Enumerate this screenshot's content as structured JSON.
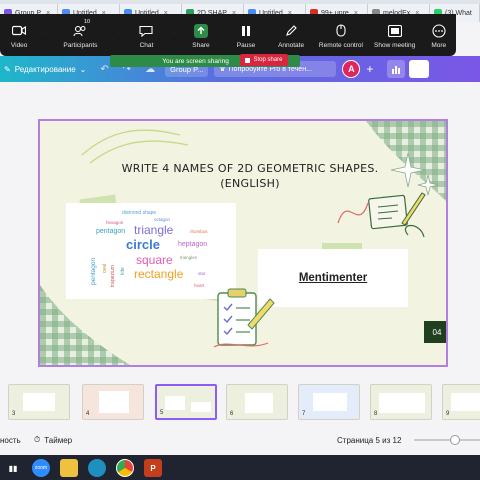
{
  "browser": {
    "tabs": [
      {
        "label": "Group P",
        "color": "#7a57e6"
      },
      {
        "label": "Untitled",
        "color": "#4c8bf5"
      },
      {
        "label": "Untitled",
        "color": "#4c8bf5"
      },
      {
        "label": "2D SHAP",
        "color": "#2aa05a"
      },
      {
        "label": "Untitled",
        "color": "#4c8bf5"
      },
      {
        "label": "99+ unre",
        "color": "#d93025"
      },
      {
        "label": "melodEx",
        "color": "#8a8a8a"
      },
      {
        "label": "(3) What",
        "color": "#25d366"
      }
    ]
  },
  "zoom": {
    "items": [
      {
        "label": "Video",
        "icon": "video-icon"
      },
      {
        "label": "Participants",
        "icon": "participants-icon",
        "count": "10"
      },
      {
        "label": "Chat",
        "icon": "chat-icon"
      },
      {
        "label": "Share",
        "icon": "share-screen-icon"
      },
      {
        "label": "Pause",
        "icon": "pause-icon"
      },
      {
        "label": "Annotate",
        "icon": "annotate-icon"
      },
      {
        "label": "Remote control",
        "icon": "remote-control-icon"
      },
      {
        "label": "Show meeting",
        "icon": "show-meeting-icon"
      },
      {
        "label": "More",
        "icon": "more-icon"
      }
    ],
    "sharing_text": "You are screen sharing",
    "stop_share": "Stop share",
    "accent": "#2e8b47",
    "stop_color": "#d7263d"
  },
  "app": {
    "mode": "Редактирование",
    "group_label": "Group P...",
    "pro_text": "Попробуйте Pro в течен...",
    "avatar": "A"
  },
  "slide": {
    "title": "WRITE 4 NAMES OF 2D GEOMETRIC SHAPES. (ENGLISH)",
    "mentimeter": "Mentimenter",
    "page": "04",
    "wordcloud": [
      {
        "text": "diamond shape",
        "color": "#5aa0d8"
      },
      {
        "text": "triangle",
        "color": "#7b6fd6"
      },
      {
        "text": "circle",
        "color": "#3a7bd5"
      },
      {
        "text": "square",
        "color": "#e45ab0"
      },
      {
        "text": "rectangle",
        "color": "#f0a020"
      },
      {
        "text": "pentagon",
        "color": "#3aa0c8"
      },
      {
        "text": "heptagon",
        "color": "#c060d0"
      },
      {
        "text": "pentagon",
        "color": "#4aa0d0"
      },
      {
        "text": "hexagon",
        "color": "#d85080"
      },
      {
        "text": "octagon",
        "color": "#5a8fd0"
      },
      {
        "text": "rhombus",
        "color": "#e07040"
      },
      {
        "text": "triangles",
        "color": "#7aa070"
      },
      {
        "text": "oval",
        "color": "#c09030"
      },
      {
        "text": "trapezium",
        "color": "#d05050"
      },
      {
        "text": "kite",
        "color": "#50a0a0"
      },
      {
        "text": "star",
        "color": "#a070d0"
      },
      {
        "text": "heart",
        "color": "#e06080"
      }
    ]
  },
  "thumbnails": [
    {
      "n": "3"
    },
    {
      "n": "4"
    },
    {
      "n": "5"
    },
    {
      "n": "6"
    },
    {
      "n": "7"
    },
    {
      "n": "8"
    },
    {
      "n": "9"
    }
  ],
  "footer": {
    "notes": "ность",
    "timer": "Таймер",
    "page": "Страница 5 из 12"
  }
}
